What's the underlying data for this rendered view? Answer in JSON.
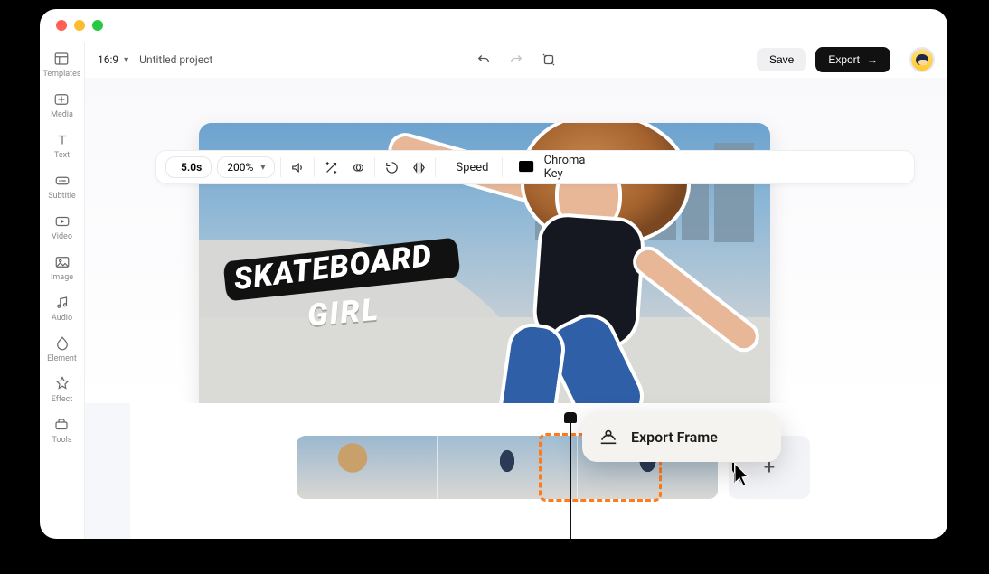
{
  "colors": {
    "accent_orange": "#ff7a1a",
    "black": "#111111",
    "panel": "#f5f3ef"
  },
  "window": {
    "traffic": [
      "close",
      "minimize",
      "zoom"
    ]
  },
  "sidebar": {
    "items": [
      {
        "label": "Templates"
      },
      {
        "label": "Media"
      },
      {
        "label": "Text"
      },
      {
        "label": "Subtitle"
      },
      {
        "label": "Video"
      },
      {
        "label": "Image"
      },
      {
        "label": "Audio"
      },
      {
        "label": "Element"
      },
      {
        "label": "Effect"
      },
      {
        "label": "Tools"
      }
    ]
  },
  "topbar": {
    "aspect_ratio": "16:9",
    "project_name": "Untitled project",
    "save_label": "Save",
    "export_label": "Export"
  },
  "toolbar": {
    "duration": "5.0s",
    "zoom": "200%",
    "speed_label": "Speed",
    "chroma_label": "Chroma Key"
  },
  "canvas": {
    "overlay_text_line1": "SKATEBOARD",
    "overlay_text_line2": "GIRL"
  },
  "context_menu": {
    "export_frame_label": "Export Frame"
  },
  "timeline": {
    "clips": [
      {
        "id": "clip-1"
      },
      {
        "id": "clip-2"
      },
      {
        "id": "clip-3",
        "selected": true
      }
    ],
    "add_label": "+"
  }
}
